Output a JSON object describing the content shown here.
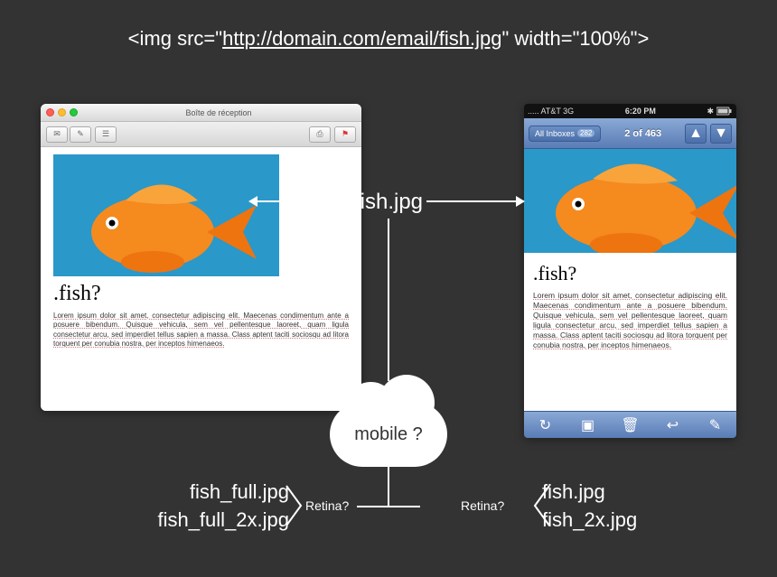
{
  "top_code": {
    "prefix": "<img src=\"",
    "url": "http://domain.com/email/fish.jpg",
    "suffix": "\" width=\"100%\">"
  },
  "desktop": {
    "window_title": "Boîte de réception",
    "content_heading": ".fish?",
    "lorem": "Lorem ipsum dolor sit amet, consectetur adipiscing elit. Maecenas condimentum ante a posuere bibendum. Quisque vehicula, sem vel pellentesque laoreet, quam ligula consectetur arcu, sed imperdiet tellus sapien a massa. Class aptent taciti sociosqu ad litora torquent per conubia nostra, per inceptos himenaeos."
  },
  "phone": {
    "status": {
      "left": ".....  AT&T  3G",
      "center": "6:20 PM",
      "bt": "✱"
    },
    "nav_back_label": "All Inboxes",
    "nav_back_badge": "282",
    "nav_title": "2 of 463",
    "content_heading": ".fish?",
    "lorem": "Lorem ipsum dolor sit amet, consectetur adipiscing elit. Maecenas condimentum ante a posuere bibendum. Quisque vehicula, sem vel pellentesque laoreet, quam ligula consectetur arcu, sed imperdiet tellus sapien a massa. Class aptent taciti sociosqu ad litora torquent per conubia nostra, per inceptos himenaeos."
  },
  "flow": {
    "center_label": "fish.jpg",
    "cloud_label": "mobile ?",
    "retina_label": "Retina?",
    "left_files": [
      "fish_full.jpg",
      "fish_full_2x.jpg"
    ],
    "right_files": [
      "fish.jpg",
      "fish_2x.jpg"
    ]
  }
}
